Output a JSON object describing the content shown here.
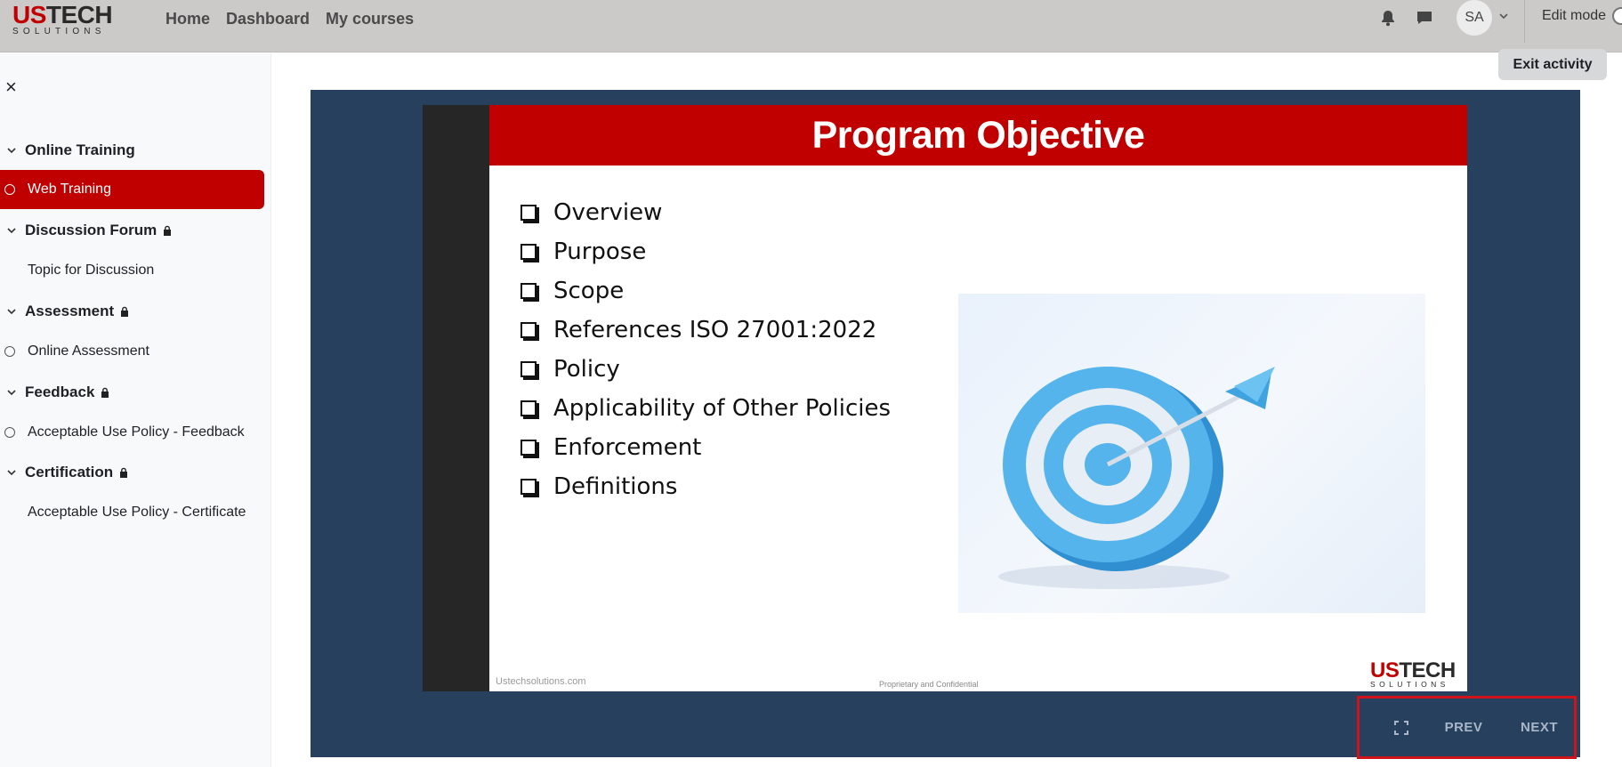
{
  "brand": {
    "logo_top_us": "US",
    "logo_top_tech": "TECH",
    "logo_sub": "SOLUTIONS"
  },
  "nav": {
    "links": [
      "Home",
      "Dashboard",
      "My courses"
    ]
  },
  "user": {
    "initials": "SA",
    "edit_mode_label": "Edit mode"
  },
  "icons": {
    "notifications": "bell-icon",
    "messages": "chat-icon",
    "user_menu": "chevron-down-icon",
    "close_drawer": "close-icon",
    "fullscreen": "fullscreen-icon",
    "lock": "lock-icon"
  },
  "colors": {
    "brand_red": "#c00000",
    "player_bg": "#26405d",
    "navbar_bg": "#ccc9c9",
    "highlight_border": "#d0121a"
  },
  "sidebar": {
    "close_label": "×",
    "sections": [
      {
        "title": "Online Training",
        "locked": false,
        "items": [
          {
            "label": "Web Training",
            "active": true,
            "marker": "circle"
          }
        ]
      },
      {
        "title": "Discussion Forum",
        "locked": true,
        "items": [
          {
            "label": "Topic for Discussion",
            "active": false,
            "marker": "none"
          }
        ]
      },
      {
        "title": "Assessment",
        "locked": true,
        "items": [
          {
            "label": "Online Assessment",
            "active": false,
            "marker": "circle"
          }
        ]
      },
      {
        "title": "Feedback",
        "locked": true,
        "items": [
          {
            "label": "Acceptable Use Policy - Feedback",
            "active": false,
            "marker": "circle"
          }
        ]
      },
      {
        "title": "Certification",
        "locked": true,
        "items": [
          {
            "label": "Acceptable Use Policy - Certificate",
            "active": false,
            "marker": "none"
          }
        ]
      }
    ]
  },
  "activity": {
    "exit_label": "Exit activity"
  },
  "slide": {
    "title": "Program Objective",
    "bullets": [
      "Overview",
      "Purpose",
      "Scope",
      "References ISO 27001:2022",
      "Policy",
      "Applicability of Other Policies",
      "Enforcement",
      "Definitions"
    ],
    "footer_left": "Ustechsolutions.com",
    "footer_center": "Proprietary and Confidential",
    "logo_top_us": "US",
    "logo_top_tech": "TECH",
    "logo_sub": "SOLUTIONS"
  },
  "controls": {
    "prev_label": "PREV",
    "next_label": "NEXT"
  }
}
